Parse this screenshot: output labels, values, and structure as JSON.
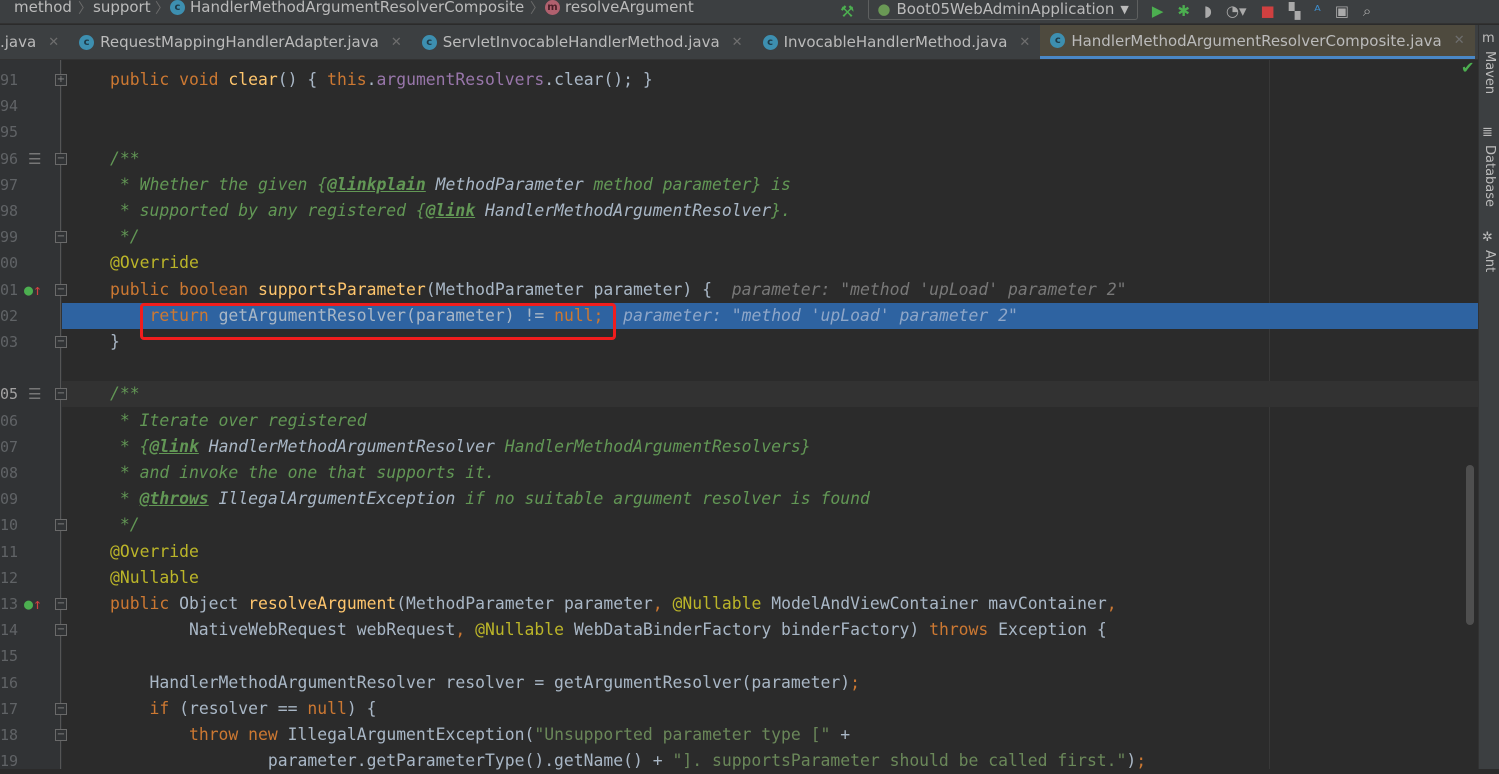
{
  "breadcrumb": [
    {
      "label": "method"
    },
    {
      "label": "support"
    },
    {
      "label": "HandlerMethodArgumentResolverComposite",
      "icon": "class-icon"
    },
    {
      "label": "resolveArgument",
      "icon": "method-icon"
    }
  ],
  "toolbar": {
    "run_config": "Boot05WebAdminApplication"
  },
  "tabs": [
    {
      "label": ".java"
    },
    {
      "label": "RequestMappingHandlerAdapter.java"
    },
    {
      "label": "ServletInvocableHandlerMethod.java"
    },
    {
      "label": "InvocableHandlerMethod.java"
    },
    {
      "label": "HandlerMethodArgumentResolverComposite.java",
      "active": true
    }
  ],
  "right_tools": [
    "Maven",
    "Database",
    "Ant"
  ],
  "colors": {
    "keyword": "#cc7832",
    "method": "#ffc66d",
    "comment": "#629755",
    "annotation": "#bbb529",
    "string": "#6a8759",
    "highlight": "#2e63a1",
    "box": "#f01d1d"
  },
  "lines": [
    {
      "n": "91",
      "t": [
        [
          "kw",
          "public void "
        ],
        [
          "fn",
          "clear"
        ],
        [
          "",
          "() { "
        ],
        [
          "kw",
          "this"
        ],
        [
          "",
          "."
        ],
        [
          "fd",
          "argumentResolvers"
        ],
        [
          "",
          ".clear(); }"
        ]
      ]
    },
    {
      "n": "94",
      "t": []
    },
    {
      "n": "95",
      "t": []
    },
    {
      "n": "96",
      "t": [
        [
          "cm",
          "/**"
        ]
      ]
    },
    {
      "n": "97",
      "t": [
        [
          "cm",
          " * Whether the given {"
        ],
        [
          "ct",
          "@linkplain"
        ],
        [
          "cc",
          " MethodParameter"
        ],
        [
          "cm",
          " method parameter} is"
        ]
      ]
    },
    {
      "n": "98",
      "t": [
        [
          "cm",
          " * supported by any registered {"
        ],
        [
          "ct",
          "@link"
        ],
        [
          "cc",
          " HandlerMethodArgumentResolver"
        ],
        [
          "cm",
          "}."
        ]
      ]
    },
    {
      "n": "99",
      "t": [
        [
          "cm",
          " */"
        ]
      ]
    },
    {
      "n": "00",
      "t": [
        [
          "an",
          "@Override"
        ]
      ]
    },
    {
      "n": "01",
      "t": [
        [
          "kw",
          "public boolean "
        ],
        [
          "fn",
          "supportsParameter"
        ],
        [
          "",
          "(MethodParameter parameter) {  "
        ],
        [
          "hint",
          "parameter: \"method 'upLoad' parameter 2\""
        ]
      ]
    },
    {
      "n": "02",
      "hl": true,
      "t": [
        [
          "",
          "    "
        ],
        [
          "kw",
          "return "
        ],
        [
          "",
          "getArgumentResolver(parameter) != "
        ],
        [
          "kw",
          "null;"
        ],
        [
          "",
          "  "
        ],
        [
          "hlhint",
          "parameter: \"method 'upLoad' parameter 2\""
        ]
      ]
    },
    {
      "n": "03",
      "t": [
        [
          "",
          "}"
        ]
      ]
    },
    {
      "n": "",
      "t": []
    },
    {
      "n": "05",
      "cur": true,
      "t": [
        [
          "cm",
          "/**"
        ]
      ]
    },
    {
      "n": "06",
      "t": [
        [
          "cm",
          " * Iterate over registered"
        ]
      ]
    },
    {
      "n": "07",
      "t": [
        [
          "cm",
          " * {"
        ],
        [
          "ct",
          "@link"
        ],
        [
          "cc",
          " HandlerMethodArgumentResolver"
        ],
        [
          "cm",
          " HandlerMethodArgumentResolvers}"
        ]
      ]
    },
    {
      "n": "08",
      "t": [
        [
          "cm",
          " * and invoke the one that supports it."
        ]
      ]
    },
    {
      "n": "09",
      "t": [
        [
          "cm",
          " * "
        ],
        [
          "ct",
          "@throws"
        ],
        [
          "cc",
          " IllegalArgumentException"
        ],
        [
          "cm",
          " if no suitable argument resolver is found"
        ]
      ]
    },
    {
      "n": "10",
      "t": [
        [
          "cm",
          " */"
        ]
      ]
    },
    {
      "n": "11",
      "t": [
        [
          "an",
          "@Override"
        ]
      ]
    },
    {
      "n": "12",
      "t": [
        [
          "an",
          "@Nullable"
        ]
      ]
    },
    {
      "n": "13",
      "t": [
        [
          "kw",
          "public "
        ],
        [
          "",
          "Object "
        ],
        [
          "fn",
          "resolveArgument"
        ],
        [
          "",
          "(MethodParameter parameter"
        ],
        [
          "kw",
          ", "
        ],
        [
          "an",
          "@Nullable "
        ],
        [
          "",
          "ModelAndViewContainer mavContainer"
        ],
        [
          "kw",
          ","
        ]
      ]
    },
    {
      "n": "14",
      "t": [
        [
          "",
          "        NativeWebRequest webRequest"
        ],
        [
          "kw",
          ", "
        ],
        [
          "an",
          "@Nullable "
        ],
        [
          "",
          "WebDataBinderFactory binderFactory) "
        ],
        [
          "kw",
          "throws "
        ],
        [
          "",
          "Exception {"
        ]
      ]
    },
    {
      "n": "15",
      "t": []
    },
    {
      "n": "16",
      "t": [
        [
          "",
          "    HandlerMethodArgumentResolver resolver = getArgumentResolver(parameter)"
        ],
        [
          "kw",
          ";"
        ]
      ]
    },
    {
      "n": "17",
      "t": [
        [
          "",
          "    "
        ],
        [
          "kw",
          "if "
        ],
        [
          "",
          "(resolver == "
        ],
        [
          "kw",
          "null"
        ],
        [
          "",
          ") {"
        ]
      ]
    },
    {
      "n": "18",
      "t": [
        [
          "",
          "        "
        ],
        [
          "kw",
          "throw new "
        ],
        [
          "",
          "IllegalArgumentException("
        ],
        [
          "st",
          "\"Unsupported parameter type [\" "
        ],
        [
          "",
          "+"
        ]
      ]
    },
    {
      "n": "19",
      "t": [
        [
          "",
          "                parameter.getParameterType().getName() + "
        ],
        [
          "st",
          "\"]. supportsParameter should be called first.\""
        ],
        [
          "",
          ")"
        ],
        [
          "kw",
          ";"
        ]
      ]
    }
  ]
}
